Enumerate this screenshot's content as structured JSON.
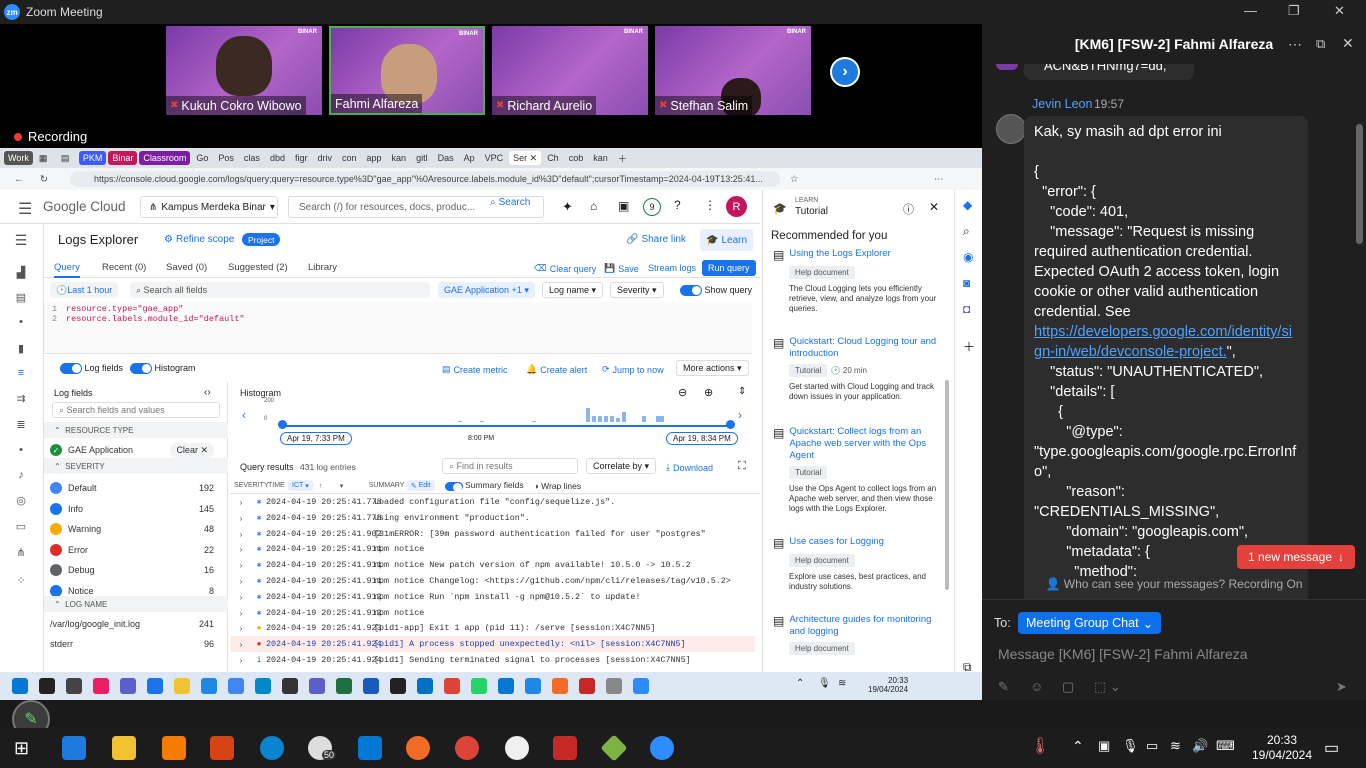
{
  "zoom": {
    "title": "Zoom Meeting",
    "logo": "zm",
    "participants": [
      {
        "name": "Kukuh Cokro Wibowo",
        "muted": true
      },
      {
        "name": "Fahmi Alfareza",
        "muted": false
      },
      {
        "name": "Richard Aurelio",
        "muted": true
      },
      {
        "name": "Stefhan Salim",
        "muted": true
      }
    ],
    "tile_brand": "BINAR",
    "recording_label": "Recording"
  },
  "browser": {
    "tabs": [
      "Work",
      "PKM",
      "Binar",
      "Classroom",
      "Go",
      "Pos",
      "clas",
      "dbd",
      "figr",
      "driv",
      "con",
      "app",
      "kan",
      "gitl",
      "Das",
      "Ap",
      "VPC",
      "Ser",
      "Ch",
      "cob",
      "kan"
    ],
    "url": "https://console.cloud.google.com/logs/query;query=resource.type%3D\"gae_app\"%0Aresource.labels.module_id%3D\"default\";cursorTimestamp=2024-04-19T13:25:41...",
    "product": "Google Cloud",
    "project": "Kampus Merdeka Binar",
    "search_placeholder": "Search (/) for resources, docs, produc...",
    "search_label": "Search",
    "badge": "9",
    "avatar": "R",
    "page_title": "Logs Explorer",
    "refine_scope": "Refine scope",
    "project_chip": "Project",
    "share_link": "Share link",
    "learn": "Learn",
    "query_tabs": [
      "Query",
      "Recent (0)",
      "Saved (0)",
      "Suggested (2)",
      "Library"
    ],
    "clear_query": "Clear query",
    "save": "Save",
    "stream_logs": "Stream logs",
    "run_query": "Run query",
    "last_hour": "Last 1 hour",
    "search_fields": "Search all fields",
    "gae_chip": "GAE Application +1",
    "log_name": "Log name",
    "severity": "Severity",
    "show_query": "Show query",
    "query_lines": [
      "resource.type=\"gae_app\"",
      "resource.labels.module_id=\"default\""
    ],
    "log_fields_toggle": "Log fields",
    "histogram_toggle": "Histogram",
    "create_metric": "Create metric",
    "create_alert": "Create alert",
    "jump_now": "Jump to now",
    "more_actions": "More actions",
    "log_fields_title": "Log fields",
    "search_fields_values": "Search fields and values",
    "resource_type": "RESOURCE TYPE",
    "gae_application": "GAE Application",
    "clear": "Clear",
    "severity_title": "SEVERITY",
    "severities": [
      {
        "name": "Default",
        "count": "192",
        "color": "#4285f4"
      },
      {
        "name": "Info",
        "count": "145",
        "color": "#1a73e8"
      },
      {
        "name": "Warning",
        "count": "48",
        "color": "#f9ab00"
      },
      {
        "name": "Error",
        "count": "22",
        "color": "#d93025"
      },
      {
        "name": "Debug",
        "count": "16",
        "color": "#5f6368"
      },
      {
        "name": "Notice",
        "count": "8",
        "color": "#1a73e8"
      }
    ],
    "log_name_title": "LOG NAME",
    "log_names": [
      {
        "name": "/var/log/google_init.log",
        "count": "241"
      },
      {
        "name": "stderr",
        "count": "96"
      }
    ],
    "histogram_title": "Histogram",
    "hist_axis": [
      "200",
      "0"
    ],
    "time_start": "Apr 19, 7:33 PM",
    "time_mid": "8:00 PM",
    "time_end": "Apr 19, 8:34 PM",
    "query_results": "Query results",
    "log_entries": "431 log entries",
    "find_results": "Find in results",
    "correlate": "Correlate by",
    "download": "Download",
    "col_severity": "SEVERITY",
    "col_time": "TIME",
    "col_ict": "ICT",
    "col_summary": "SUMMARY",
    "edit": "Edit",
    "summary_fields": "Summary fields",
    "wrap_lines": "Wrap lines",
    "log_rows": [
      {
        "time": "2024-04-19 20:25:41.778",
        "msg": "Loaded configuration file \"config/sequelize.js\".",
        "sev": "default"
      },
      {
        "time": "2024-04-19 20:25:41.778",
        "msg": "Using environment \"production\".",
        "sev": "default"
      },
      {
        "time": "2024-04-19 20:25:41.902",
        "msg": "[31mERROR: [39m password authentication failed for user \"postgres\"",
        "sev": "default"
      },
      {
        "time": "2024-04-19 20:25:41.911",
        "msg": "npm notice",
        "sev": "default"
      },
      {
        "time": "2024-04-19 20:25:41.911",
        "msg": "npm notice New patch version of npm available! 10.5.0 -> 10.5.2",
        "sev": "default"
      },
      {
        "time": "2024-04-19 20:25:41.911",
        "msg": "npm notice Changelog: <https://github.com/npm/cli/releases/tag/v10.5.2>",
        "sev": "default"
      },
      {
        "time": "2024-04-19 20:25:41.912",
        "msg": "npm notice Run `npm install -g npm@10.5.2` to update!",
        "sev": "default"
      },
      {
        "time": "2024-04-19 20:25:41.912",
        "msg": "npm notice",
        "sev": "default"
      },
      {
        "time": "2024-04-19 20:25:41.923",
        "msg": "[pid1-app] Exit 1 app (pid 11): /serve [session:X4C7NN5]",
        "sev": "warning"
      },
      {
        "time": "2024-04-19 20:25:41.924",
        "msg": "[pid1] A process stopped unexpectedly: <nil> [session:X4C7NN5]",
        "sev": "error"
      },
      {
        "time": "2024-04-19 20:25:41.924",
        "msg": "[pid1] Sending terminated signal to processes [session:X4C7NN5]",
        "sev": "info"
      }
    ],
    "tutorial_label": "LEARN",
    "tutorial_title": "Tutorial",
    "recommended": "Recommended for you",
    "cards": [
      {
        "title": "Using the Logs Explorer",
        "tag": "Help document",
        "desc": "The Cloud Logging lets you efficiently retrieve, view, and analyze logs from your queries."
      },
      {
        "title": "Quickstart: Cloud Logging tour and introduction",
        "tag": "Tutorial",
        "extra": "20 min",
        "desc": "Get started with Cloud Logging and track down issues in your application."
      },
      {
        "title": "Quickstart: Collect logs from an Apache web server with the Ops Agent",
        "tag": "Tutorial",
        "desc": "Use the Ops Agent to collect logs from an Apache web server, and then view those logs with the Logs Explorer."
      },
      {
        "title": "Use cases for Logging",
        "tag": "Help document",
        "desc": "Explore use cases, best practices, and industry solutions."
      },
      {
        "title": "Architecture guides for monitoring and logging",
        "tag": "Help document",
        "desc": ""
      }
    ],
    "inner_clock": {
      "time": "20:33",
      "date": "19/04/2024"
    }
  },
  "chat": {
    "title": "[KM6] [FSW-2] Fahmi Alfareza",
    "prev_snippet": "ACN&BTHNmg7=dd,",
    "sender": "Jevin Leon",
    "sent_time": "19:57",
    "message_lines": [
      "Kak, sy masih ad dpt error ini",
      "",
      "{",
      "  \"error\": {",
      "    \"code\": 401,",
      "    \"message\": \"Request is missing required authentication credential. Expected OAuth 2 access token, login cookie or other valid authentication credential. See ",
      "https://developers.google.com/identity/sign-in/web/devconsole-project.",
      "\",",
      "    \"status\": \"UNAUTHENTICATED\",",
      "    \"details\": [",
      "      {",
      "        \"@type\":",
      "\"type.googleapis.com/google.rpc.ErrorInfo\",",
      "        \"reason\":",
      "\"CREDENTIALS_MISSING\",",
      "        \"domain\": \"googleapis.com\",",
      "        \"metadata\": {",
      "          \"method\":"
    ],
    "new_message_btn": "1 new message",
    "who_can_see": "Who can see your messages? Recording On",
    "to_label": "To:",
    "to_target": "Meeting Group Chat",
    "compose_placeholder": "Message [KM6] [FSW-2] Fahmi Alfareza"
  },
  "taskbar": {
    "time": "20:33",
    "date": "19/04/2024",
    "whatsapp_badge": "50"
  }
}
